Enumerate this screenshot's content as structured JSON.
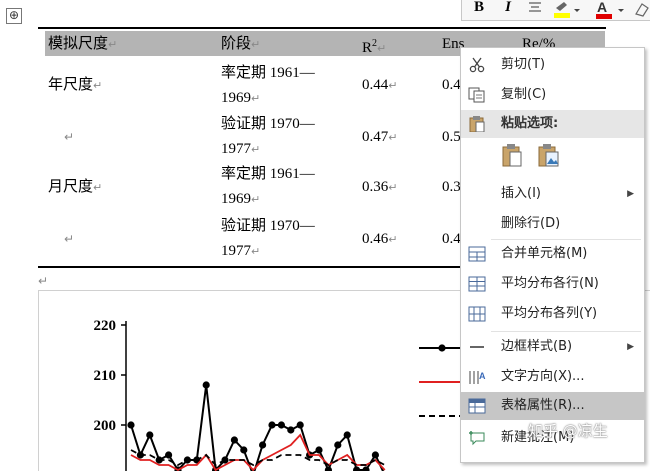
{
  "table": {
    "move_handle_glyph": "⊕",
    "headers": [
      "模拟尺度",
      "阶段",
      "R²",
      "Ens",
      "Re/%"
    ],
    "header_parts": {
      "r": "R",
      "sup": "2"
    },
    "paragraph_mark": "↵",
    "rows": [
      {
        "scale": "年尺度",
        "stage_line1": "率定期 1961—",
        "stage_line2": "1969",
        "r2": "0.44",
        "ens": "0.4"
      },
      {
        "scale": "",
        "stage_line1": "验证期 1970—",
        "stage_line2": "1977",
        "r2": "0.47",
        "ens": "0.5"
      },
      {
        "scale": "月尺度",
        "stage_line1": "率定期 1961—",
        "stage_line2": "1969",
        "r2": "0.36",
        "ens": "0.3"
      },
      {
        "scale": "",
        "stage_line1": "验证期 1970—",
        "stage_line2": "1977",
        "r2": "0.46",
        "ens": "0.4"
      }
    ]
  },
  "chart_data": {
    "type": "line",
    "y_ticks": [
      "220",
      "210",
      "200"
    ],
    "ylim": [
      190,
      220
    ],
    "series": [
      {
        "values": [
          200,
          194,
          198,
          193,
          194,
          191,
          193,
          193,
          208,
          191,
          193,
          197,
          195,
          190,
          196,
          200,
          200,
          199,
          200,
          194,
          195,
          191,
          196,
          198,
          191,
          191,
          194,
          190
        ],
        "color": "#000000",
        "style": "solid-marker"
      },
      {
        "values": [
          194,
          193,
          193,
          192,
          192,
          191,
          192,
          192,
          194,
          191,
          192,
          193,
          193,
          191,
          193,
          194,
          195,
          196,
          198,
          194,
          194,
          192,
          193,
          194,
          192,
          192,
          193,
          191
        ],
        "color": "#e02020",
        "style": "solid"
      },
      {
        "values": [
          195,
          194,
          194,
          193,
          193,
          192,
          193,
          193,
          194,
          192,
          193,
          193,
          193,
          192,
          193,
          193,
          194,
          194,
          194,
          193,
          193,
          192,
          193,
          193,
          192,
          192,
          193,
          192
        ],
        "color": "#000000",
        "style": "dashed"
      }
    ]
  },
  "mini_toolbar": {
    "bold": "B",
    "italic": "I",
    "highlight_color": "#ffff00",
    "font_color": "#e00000"
  },
  "context_menu": {
    "items": [
      {
        "label": "剪切(T)",
        "icon": "scissors-icon"
      },
      {
        "label": "复制(C)",
        "icon": "copy-icon"
      },
      {
        "label": "粘贴选项:",
        "icon": "clipboard-icon"
      },
      {
        "label": "插入(I)",
        "icon": "",
        "submenu": true
      },
      {
        "label": "删除行(D)",
        "icon": ""
      },
      {
        "label": "合并单元格(M)",
        "icon": "merge-cells-icon"
      },
      {
        "label": "平均分布各行(N)",
        "icon": "distribute-rows-icon"
      },
      {
        "label": "平均分布各列(Y)",
        "icon": "distribute-columns-icon"
      },
      {
        "label": "边框样式(B)",
        "icon": "border-style-icon",
        "submenu": true
      },
      {
        "label": "文字方向(X)...",
        "icon": "text-direction-icon"
      },
      {
        "label": "表格属性(R)...",
        "icon": "table-properties-icon"
      },
      {
        "label": "新建批注(M)",
        "icon": "new-comment-icon"
      }
    ],
    "submenu_arrow": "▶",
    "highlight_color": "#c6c6c6"
  },
  "watermark": "知乎 @凉生"
}
